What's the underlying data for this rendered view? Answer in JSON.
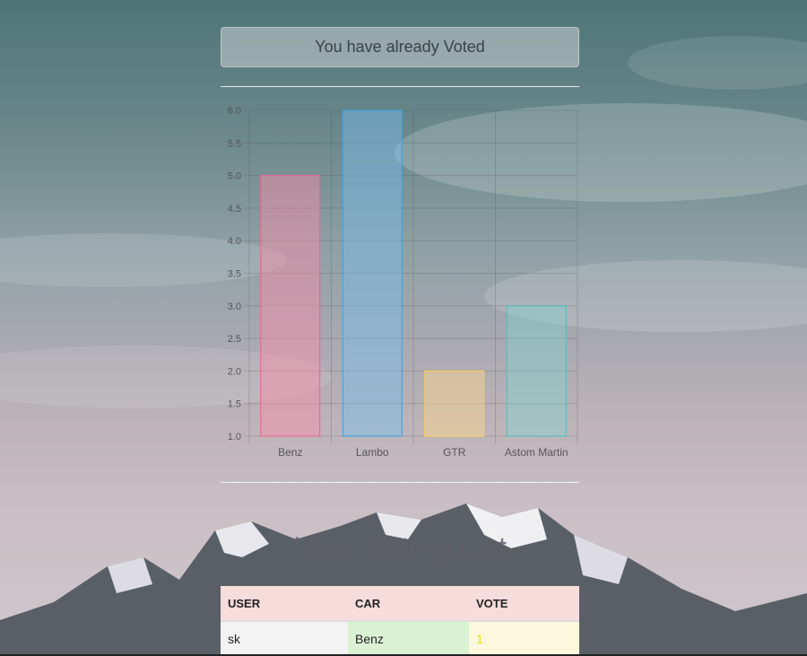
{
  "status": {
    "voted_message": "You have already Voted"
  },
  "chart_data": {
    "type": "bar",
    "categories": [
      "Benz",
      "Lambo",
      "GTR",
      "Astom Martin"
    ],
    "values": [
      5,
      6,
      2,
      3
    ],
    "ylim": [
      1,
      6
    ],
    "yticks": [
      "6.0",
      "5.5",
      "5.0",
      "4.5",
      "4.0",
      "3.5",
      "3.0",
      "2.5",
      "2.0",
      "1.5",
      "1.0"
    ],
    "grid": true,
    "bar_colors": [
      {
        "fill": "rgba(255,140,170,0.45)",
        "stroke": "#f0608a"
      },
      {
        "fill": "rgba(120,190,240,0.45)",
        "stroke": "#36a2eb"
      },
      {
        "fill": "rgba(255,215,140,0.45)",
        "stroke": "#ffcd56"
      },
      {
        "fill": "rgba(120,220,215,0.35)",
        "stroke": "#4bc0c0"
      }
    ]
  },
  "list": {
    "heading": "User Voting List",
    "columns": [
      "USER",
      "CAR",
      "VOTE"
    ],
    "rows": [
      {
        "user": "sk",
        "car": "Benz",
        "vote": "1"
      }
    ]
  }
}
